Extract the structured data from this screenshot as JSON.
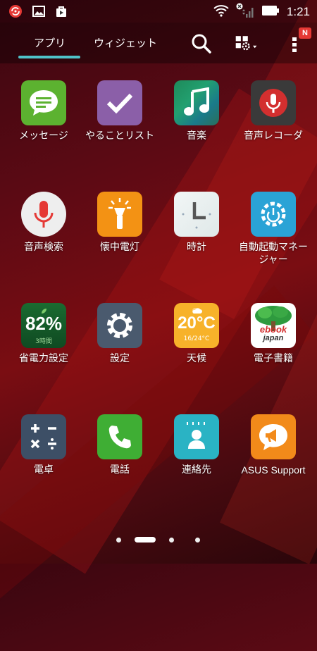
{
  "status": {
    "time": "1:21"
  },
  "tabs": {
    "apps": "アプリ",
    "widgets": "ウィジェット"
  },
  "badge": "N",
  "apps": {
    "messages": "メッセージ",
    "todo": "やることリスト",
    "music": "音楽",
    "recorder": "音声レコーダ",
    "voice_search": "音声検索",
    "flashlight": "懐中電灯",
    "clock": "時計",
    "auto_start": "自動起動マネージャー",
    "power_saver": "省電力設定",
    "settings": "設定",
    "weather": "天候",
    "ebook": "電子書籍",
    "calculator": "電卓",
    "phone": "電話",
    "contacts": "連絡先",
    "asus_support": "ASUS Support"
  },
  "power_saver_tile": {
    "percent": "82%",
    "hours": "3時間"
  },
  "weather_tile": {
    "temp": "20°C",
    "range": "16/24°C"
  },
  "ebook_tile": {
    "line1": "ebook",
    "line2": "japan"
  },
  "page_indicator": {
    "pages": 4,
    "current": 2
  },
  "colors": {
    "accent": "#4fc3c9",
    "messages": "#5cb230",
    "todo": "#8b5fa8",
    "recorder": "#3a3a3a",
    "flashlight": "#f39214",
    "auto_start": "#2aa3d6",
    "power_saver": "#1f7a3a",
    "settings": "#4a5a6e",
    "weather": "#f7b22a",
    "calculator": "#3d4f66",
    "phone": "#3fae34",
    "contacts": "#2ab3c4",
    "asus_support": "#f28a1a"
  }
}
